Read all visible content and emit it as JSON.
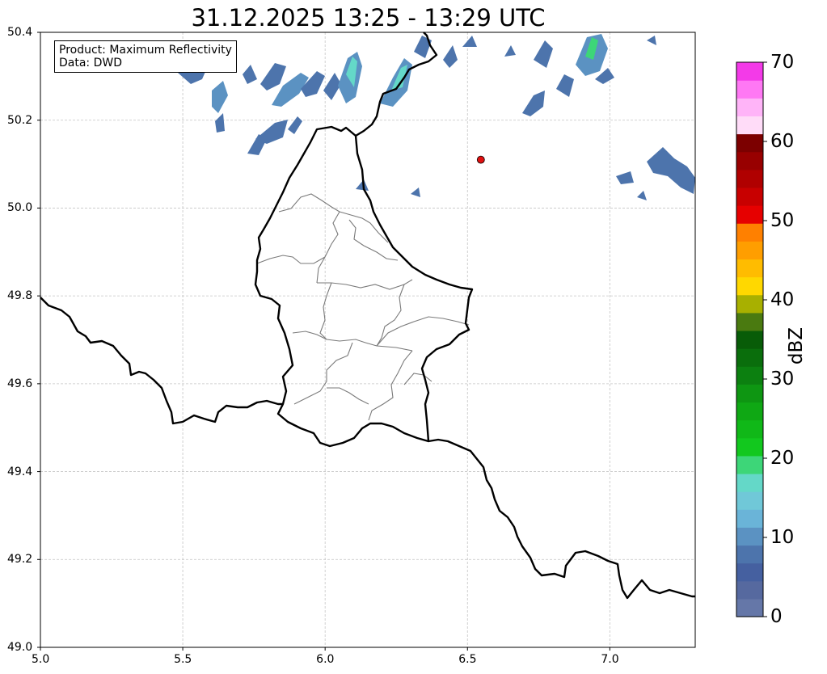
{
  "title": "31.12.2025 13:25 - 13:29 UTC",
  "info": {
    "product": "Product: Maximum Reflectivity",
    "source": "Data: DWD"
  },
  "colorbar": {
    "label": "dBZ",
    "ticks": [
      "0",
      "10",
      "20",
      "30",
      "40",
      "50",
      "60",
      "70"
    ],
    "min": 0,
    "max": 70,
    "colors": [
      "#6577a8",
      "#56699f",
      "#4560a0",
      "#4d74ac",
      "#5b92c2",
      "#6ab4d8",
      "#70c8d8",
      "#64d8c8",
      "#3dd678",
      "#12c81e",
      "#10b818",
      "#0fa814",
      "#0e9612",
      "#0c8010",
      "#0a6e0c",
      "#085c08",
      "#4a7a10",
      "#a8b000",
      "#ffd800",
      "#ffbc00",
      "#ff9e00",
      "#ff8000",
      "#e60000",
      "#c80000",
      "#b00000",
      "#980000",
      "#7c0000",
      "#ffdcf8",
      "#ffb4f8",
      "#ff78f4",
      "#f33ae8"
    ]
  },
  "map": {
    "x_ticks": [
      "5.0",
      "5.5",
      "6.0",
      "6.5",
      "7.0"
    ],
    "y_ticks": [
      "49.0",
      "49.2",
      "49.4",
      "49.6",
      "49.8",
      "50.0",
      "50.2",
      "50.4"
    ],
    "xlim": [
      5.0,
      7.3
    ],
    "ylim": [
      49.0,
      50.4
    ],
    "grid": true,
    "marker": {
      "lon": 6.547,
      "lat": 50.11,
      "color": "#e01010"
    }
  }
}
